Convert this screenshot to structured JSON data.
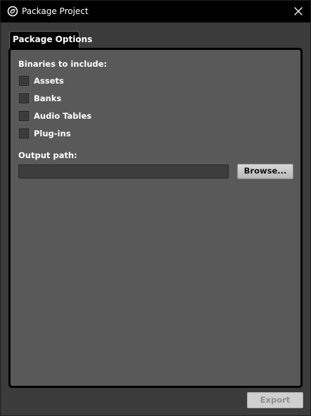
{
  "window": {
    "title": "Package Project",
    "app_icon": "wwise-logo-icon",
    "close_icon": "close-icon"
  },
  "tabs": [
    {
      "label": "Package Options",
      "selected": true
    }
  ],
  "package_options": {
    "binaries_label": "Binaries to include:",
    "binaries": [
      {
        "label": "Assets",
        "checked": false
      },
      {
        "label": "Banks",
        "checked": false
      },
      {
        "label": "Audio Tables",
        "checked": false
      },
      {
        "label": "Plug-ins",
        "checked": false
      }
    ],
    "output_path_label": "Output path:",
    "output_path_value": "",
    "browse_label": "Browse..."
  },
  "footer": {
    "export_label": "Export",
    "export_enabled": false
  },
  "colors": {
    "titlebar": "#000000",
    "window_bg": "#3b3b3b",
    "panel_bg": "#595959",
    "panel_border": "#000000",
    "text": "#ffffff"
  }
}
